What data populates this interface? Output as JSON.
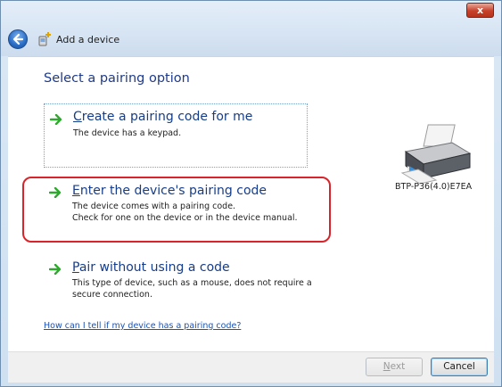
{
  "window": {
    "title": "Add a device",
    "close_glyph": "x"
  },
  "page": {
    "heading": "Select a pairing option"
  },
  "options": [
    {
      "mnemonic": "C",
      "title_rest": "reate a pairing code for me",
      "desc_lines": [
        "The device has a keypad."
      ]
    },
    {
      "mnemonic": "E",
      "title_rest": "nter the device's pairing code",
      "desc_lines": [
        "The device comes with a pairing code.",
        "Check for one on the device or in the device manual."
      ]
    },
    {
      "mnemonic": "P",
      "title_rest": "air without using a code",
      "desc_lines": [
        "This type of device, such as a mouse, does not require a",
        "secure connection."
      ]
    }
  ],
  "device": {
    "name": "BTP-P36(4.0)E7EA",
    "icon": "printer-icon"
  },
  "help_link": "How can I tell if my device has a pairing code?",
  "footer": {
    "next_mnemonic": "N",
    "next_rest": "ext",
    "cancel_label": "Cancel"
  },
  "colors": {
    "highlight": "#d8242a",
    "link": "#1a52b8",
    "heading": "#1e3a8a",
    "arrow": "#2fa82f"
  }
}
